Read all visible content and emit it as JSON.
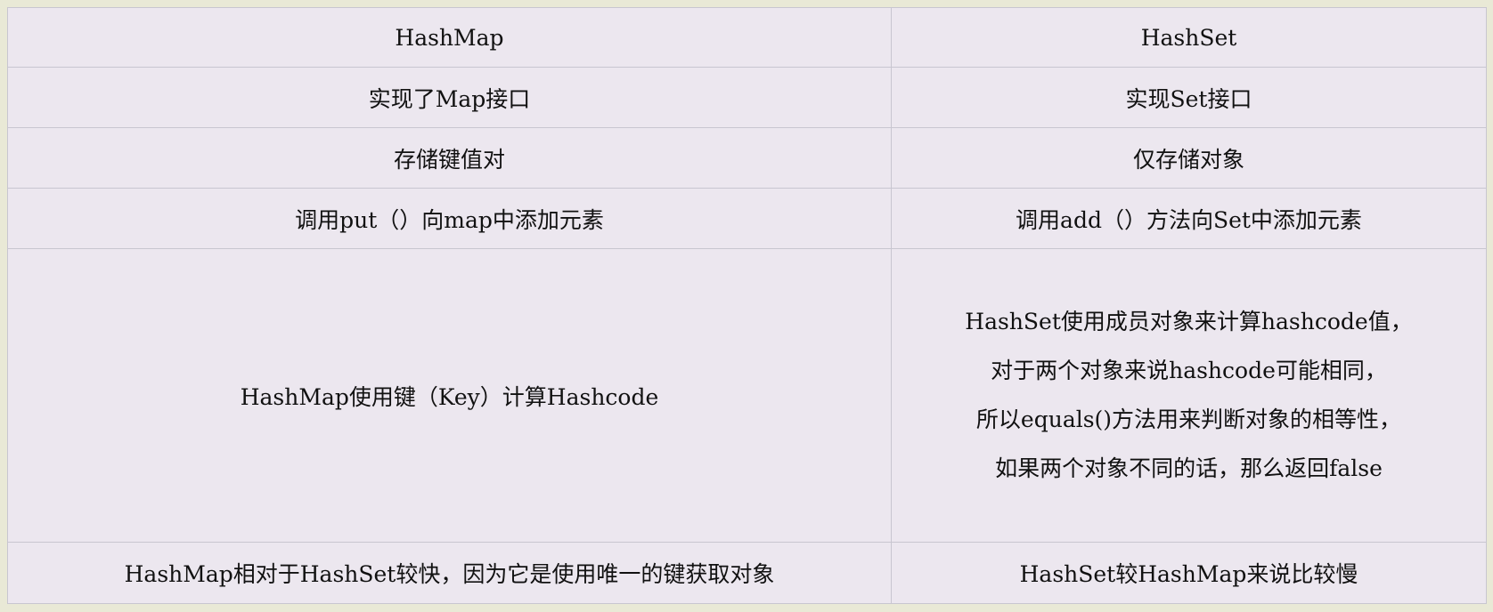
{
  "table": {
    "headers": [
      "HashMap",
      "HashSet"
    ],
    "rows": [
      [
        "实现了Map接口",
        "实现Set接口"
      ],
      [
        "存储键值对",
        "仅存储对象"
      ],
      [
        "调用put（）向map中添加元素",
        "调用add（）方法向Set中添加元素"
      ],
      [
        "HashMap使用键（Key）计算Hashcode",
        ""
      ],
      [
        "HashMap相对于HashSet较快，因为它是使用唯一的键获取对象",
        "HashSet较HashMap来说比较慢"
      ]
    ],
    "hashset_hashcode_lines": [
      "HashSet使用成员对象来计算hashcode值，",
      "对于两个对象来说hashcode可能相同，",
      "所以equals()方法用来判断对象的相等性，",
      "如果两个对象不同的话，那么返回false"
    ]
  }
}
